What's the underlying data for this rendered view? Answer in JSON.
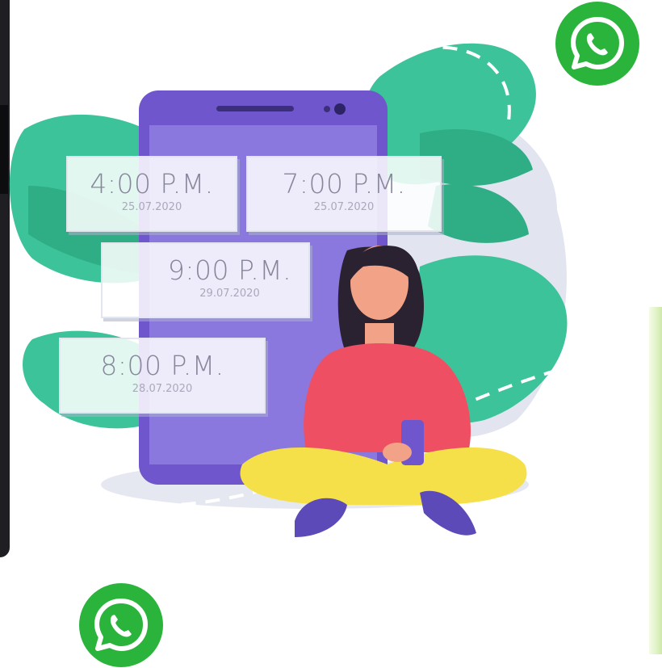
{
  "schedule_cards": [
    {
      "time": "4:00 P.M.",
      "date": "25.07.2020"
    },
    {
      "time": "7:00 P.M.",
      "date": "25.07.2020"
    },
    {
      "time": "9:00 P.M.",
      "date": "29.07.2020"
    },
    {
      "time": "8:00 P.M.",
      "date": "28.07.2020"
    }
  ],
  "icons": {
    "top_right": "whatsapp-icon",
    "bottom_left": "whatsapp-icon"
  },
  "colors": {
    "leaf": "#3cc39a",
    "phone": "#6f56cc",
    "phone_screen": "#8a78de",
    "sweater": "#ef4f62",
    "pants": "#f6e04a",
    "shoes": "#5b4ab8",
    "hair": "#2a2230",
    "skin": "#f2a286",
    "whatsapp": "#2bb43c"
  }
}
